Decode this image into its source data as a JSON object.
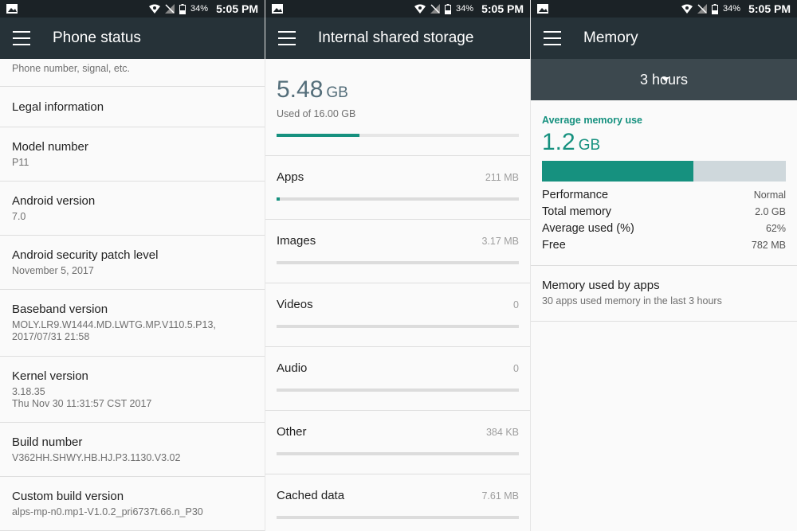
{
  "status_bar": {
    "battery": "34%",
    "time": "5:05 PM"
  },
  "phone_status": {
    "title": "Phone status",
    "items": [
      {
        "title": "",
        "subtitle": "Phone number, signal, etc."
      },
      {
        "title": "Legal information",
        "subtitle": ""
      },
      {
        "title": "Model number",
        "subtitle": "P11"
      },
      {
        "title": "Android version",
        "subtitle": "7.0"
      },
      {
        "title": "Android security patch level",
        "subtitle": "November 5, 2017"
      },
      {
        "title": "Baseband version",
        "subtitle": "MOLY.LR9.W1444.MD.LWTG.MP.V110.5.P13, 2017/07/31 21:58"
      },
      {
        "title": "Kernel version",
        "subtitle": "3.18.35\nThu Nov 30 11:31:57 CST 2017"
      },
      {
        "title": "Build number",
        "subtitle": "V362HH.SHWY.HB.HJ.P3.1130.V3.02"
      },
      {
        "title": "Custom build version",
        "subtitle": "alps-mp-n0.mp1-V1.0.2_pri6737t.66.n_P30"
      }
    ]
  },
  "storage": {
    "title": "Internal shared storage",
    "used_value": "5.48",
    "used_unit": "GB",
    "used_of": "Used of 16.00 GB",
    "used_fraction": 0.3425,
    "categories": [
      {
        "label": "Apps",
        "value": "211 MB",
        "fraction": 0.013
      },
      {
        "label": "Images",
        "value": "3.17 MB",
        "fraction": 0.0
      },
      {
        "label": "Videos",
        "value": "0",
        "fraction": 0.0
      },
      {
        "label": "Audio",
        "value": "0",
        "fraction": 0.0
      },
      {
        "label": "Other",
        "value": "384 KB",
        "fraction": 0.0
      },
      {
        "label": "Cached data",
        "value": "7.61 MB",
        "fraction": 0.0
      }
    ]
  },
  "memory": {
    "title": "Memory",
    "duration": "3 hours",
    "avg_title": "Average memory use",
    "avg_value": "1.2",
    "avg_unit": "GB",
    "used_fraction": 0.62,
    "stats": [
      {
        "label": "Performance",
        "value": "Normal"
      },
      {
        "label": "Total memory",
        "value": "2.0 GB"
      },
      {
        "label": "Average used (%)",
        "value": "62%"
      },
      {
        "label": "Free",
        "value": "782 MB"
      }
    ],
    "apps_title": "Memory used by apps",
    "apps_subtitle": "30 apps used memory in the last 3 hours"
  },
  "colors": {
    "accent": "#16917f",
    "appbar": "#263238",
    "statusbar": "#1b2226",
    "duration_bar": "#3c484e"
  }
}
